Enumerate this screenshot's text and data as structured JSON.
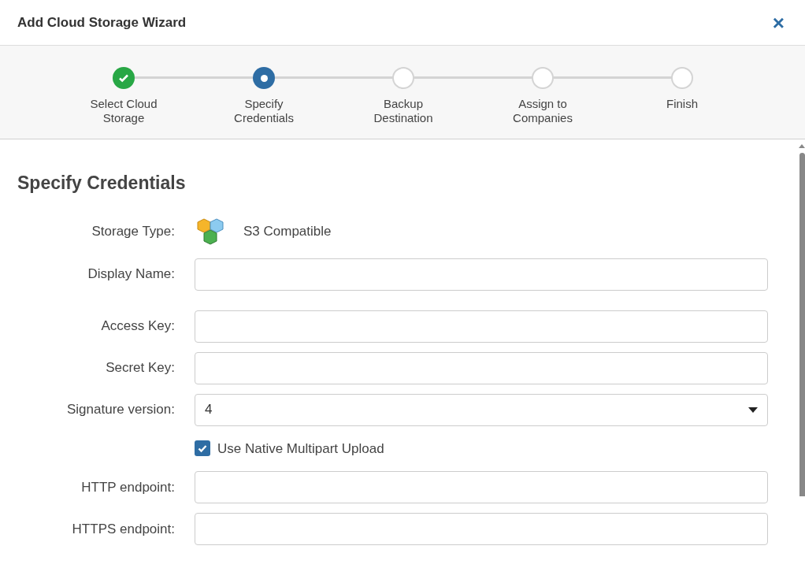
{
  "window": {
    "title": "Add Cloud Storage Wizard",
    "close": "×"
  },
  "steps": [
    {
      "label": "Select Cloud Storage",
      "kind": "done"
    },
    {
      "label": "Specify Credentials",
      "kind": "current"
    },
    {
      "label": "Backup Destination",
      "kind": "pending"
    },
    {
      "label": "Assign to Companies",
      "kind": "pending"
    },
    {
      "label": "Finish",
      "kind": "pending"
    }
  ],
  "section_title": "Specify Credentials",
  "fields": [
    {
      "kind": "static",
      "label": "Storage Type:",
      "value": "S3 Compatible"
    },
    {
      "kind": "text",
      "label": "Display Name:"
    },
    {
      "kind": "text",
      "label": "Access Key:"
    },
    {
      "kind": "text",
      "label": "Secret Key:"
    },
    {
      "kind": "select",
      "label": "Signature version:",
      "value": "4"
    },
    {
      "kind": "checkbox",
      "label": "Use Native Multipart Upload",
      "checked": true
    },
    {
      "kind": "text",
      "label": "HTTP endpoint:"
    },
    {
      "kind": "text",
      "label": "HTTPS endpoint:"
    }
  ]
}
